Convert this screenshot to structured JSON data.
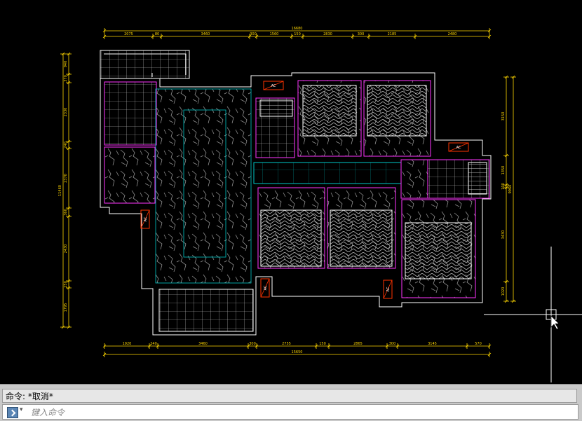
{
  "command_line": {
    "history": "命令: *取消*",
    "placeholder": "键入命令"
  },
  "drawing": {
    "top_dims": [
      "2075",
      "80",
      "3460",
      "300",
      "1560",
      "150",
      "2830",
      "300",
      "2185",
      "2480"
    ],
    "top_total": "16680",
    "bottom_dims": [
      "1920",
      "240",
      "3460",
      "300",
      "2755",
      "150",
      "2865",
      "300",
      "3145",
      "570"
    ],
    "bottom_total": "15650",
    "left_dims": [
      "940",
      "370",
      "2330",
      "240",
      "2370",
      "360",
      "2430",
      "250",
      "1795"
    ],
    "left_total": "11460",
    "right_dims": [
      "3150",
      "1350",
      "100",
      "3430",
      "1020"
    ],
    "right_total": "9960",
    "ac_label": "AC",
    "colors": {
      "background": "#000000",
      "wall": "#ffffff",
      "dimension": "#ffd700",
      "room_border": "#ff33ff",
      "cyan": "#00c8c8",
      "ac_box": "#ff3300",
      "texture": "#9a9a9a"
    }
  }
}
